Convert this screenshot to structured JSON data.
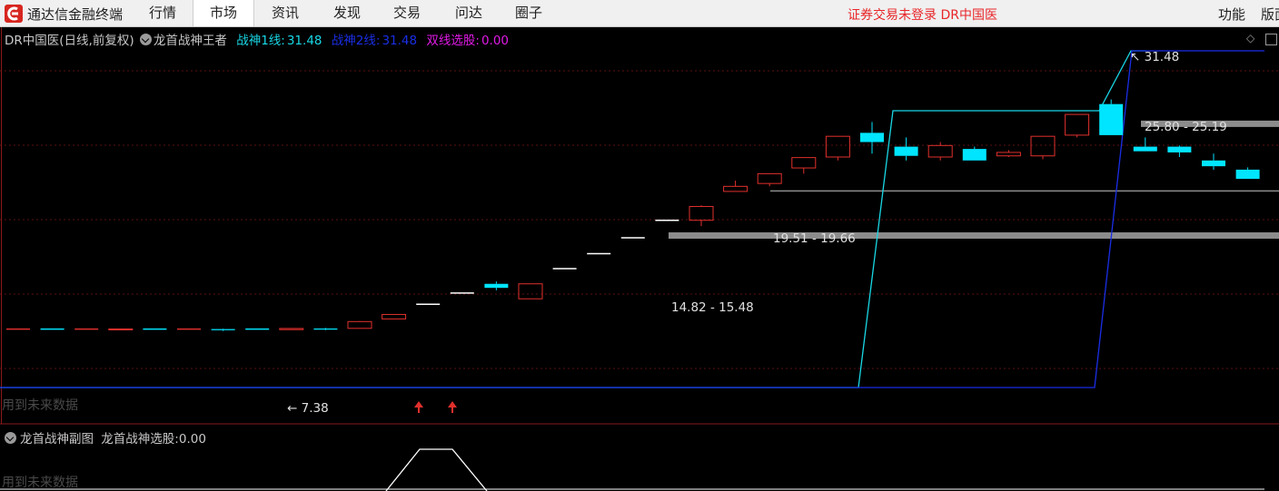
{
  "app": {
    "name": "通达信金融终端"
  },
  "menu": {
    "items": [
      "行情",
      "市场",
      "资讯",
      "发现",
      "交易",
      "问达",
      "圈子"
    ],
    "active": "市场"
  },
  "status": {
    "text": "证券交易未登录  DR中国医"
  },
  "right_menu": {
    "items": [
      "功能",
      "版面"
    ]
  },
  "chart_header": {
    "title": "DR中国医(日线,前复权)",
    "indicator": "龙首战神王者",
    "line1_label": "战神1线:",
    "line1_value": "31.48",
    "line2_label": "战神2线:",
    "line2_value": "31.48",
    "select_label": "双线选股:",
    "select_value": "0.00"
  },
  "sub_chart": {
    "title": "龙首战神副图",
    "label": "龙首战神选股:",
    "value": "0.00"
  },
  "future_data_label": "用到未来数据",
  "colors": {
    "up": "#e0302c",
    "down": "#00e5ff",
    "line1": "#19d8e6",
    "line2": "#1a2ee6",
    "zone": "#8c8c8c"
  },
  "chart_data": {
    "type": "candlestick",
    "annotations": [
      "7.38",
      "14.82 - 15.48",
      "19.51 - 19.66",
      "25.80 - 25.19",
      "31.48"
    ],
    "candles": [
      {
        "o": 7.55,
        "c": 7.55,
        "h": 7.55,
        "l": 7.55,
        "d": "up"
      },
      {
        "o": 7.55,
        "c": 7.55,
        "h": 7.55,
        "l": 7.55,
        "d": "down"
      },
      {
        "o": 7.55,
        "c": 7.55,
        "h": 7.55,
        "l": 7.55,
        "d": "up"
      },
      {
        "o": 7.56,
        "c": 7.52,
        "h": 7.56,
        "l": 7.52,
        "d": "up"
      },
      {
        "o": 7.55,
        "c": 7.55,
        "h": 7.55,
        "l": 7.55,
        "d": "down"
      },
      {
        "o": 7.55,
        "c": 7.55,
        "h": 7.55,
        "l": 7.55,
        "d": "up"
      },
      {
        "o": 7.55,
        "c": 7.45,
        "h": 7.58,
        "l": 7.38,
        "d": "down"
      },
      {
        "o": 7.55,
        "c": 7.55,
        "h": 7.55,
        "l": 7.55,
        "d": "down"
      },
      {
        "o": 7.5,
        "c": 7.6,
        "h": 7.62,
        "l": 7.48,
        "d": "up"
      },
      {
        "o": 7.5,
        "c": 7.6,
        "h": 7.65,
        "l": 7.45,
        "d": "down"
      },
      {
        "o": 7.61,
        "c": 8.2,
        "h": 8.25,
        "l": 7.61,
        "d": "up"
      },
      {
        "o": 8.43,
        "c": 8.82,
        "h": 8.82,
        "l": 8.43,
        "d": "up"
      },
      {
        "o": 9.7,
        "c": 9.7,
        "h": 9.7,
        "l": 9.7,
        "d": "up"
      },
      {
        "o": 10.68,
        "c": 10.68,
        "h": 10.68,
        "l": 10.68,
        "d": "up"
      },
      {
        "o": 11.48,
        "c": 11.13,
        "h": 11.68,
        "l": 10.93,
        "d": "down"
      },
      {
        "o": 10.18,
        "c": 11.48,
        "h": 11.48,
        "l": 10.18,
        "d": "up"
      },
      {
        "o": 12.8,
        "c": 12.8,
        "h": 12.8,
        "l": 12.8,
        "d": "up"
      },
      {
        "o": 14.1,
        "c": 14.1,
        "h": 14.1,
        "l": 14.1,
        "d": "up"
      },
      {
        "o": 15.48,
        "c": 15.48,
        "h": 15.48,
        "l": 15.48,
        "d": "up"
      },
      {
        "o": 17.0,
        "c": 17.0,
        "h": 17.0,
        "l": 17.0,
        "d": "up"
      },
      {
        "o": 17.0,
        "c": 18.2,
        "h": 18.3,
        "l": 16.5,
        "d": "up"
      },
      {
        "o": 19.51,
        "c": 19.95,
        "h": 20.45,
        "l": 19.51,
        "d": "up"
      },
      {
        "o": 20.2,
        "c": 21.05,
        "h": 21.05,
        "l": 19.95,
        "d": "up"
      },
      {
        "o": 21.55,
        "c": 22.45,
        "h": 22.45,
        "l": 21.05,
        "d": "up"
      },
      {
        "o": 22.5,
        "c": 24.3,
        "h": 24.3,
        "l": 22.2,
        "d": "up"
      },
      {
        "o": 24.6,
        "c": 23.8,
        "h": 25.55,
        "l": 22.8,
        "d": "down"
      },
      {
        "o": 23.4,
        "c": 22.6,
        "h": 24.2,
        "l": 22.2,
        "d": "down"
      },
      {
        "o": 22.5,
        "c": 23.5,
        "h": 23.8,
        "l": 22.2,
        "d": "up"
      },
      {
        "o": 23.2,
        "c": 22.2,
        "h": 23.4,
        "l": 22.2,
        "d": "down"
      },
      {
        "o": 22.6,
        "c": 22.9,
        "h": 23.1,
        "l": 22.5,
        "d": "up"
      },
      {
        "o": 22.6,
        "c": 24.3,
        "h": 24.3,
        "l": 22.3,
        "d": "up"
      },
      {
        "o": 24.4,
        "c": 26.2,
        "h": 26.2,
        "l": 24.2,
        "d": "up"
      },
      {
        "o": 27.1,
        "c": 24.4,
        "h": 27.5,
        "l": 24.4,
        "d": "down"
      },
      {
        "o": 23.4,
        "c": 23.0,
        "h": 24.2,
        "l": 23.0,
        "d": "down"
      },
      {
        "o": 23.4,
        "c": 22.9,
        "h": 23.5,
        "l": 22.5,
        "d": "down"
      },
      {
        "o": 22.2,
        "c": 21.7,
        "h": 22.8,
        "l": 21.4,
        "d": "down"
      },
      {
        "o": 21.4,
        "c": 20.6,
        "h": 21.6,
        "l": 20.6,
        "d": "down"
      }
    ],
    "levels": [
      {
        "from": 19.51,
        "to": 19.66,
        "label": "19.51 - 19.66"
      },
      {
        "from": 14.82,
        "to": 15.48,
        "label": "14.82 - 15.48"
      },
      {
        "from": 25.8,
        "to": 25.19,
        "label": "25.80 - 25.19"
      }
    ]
  }
}
